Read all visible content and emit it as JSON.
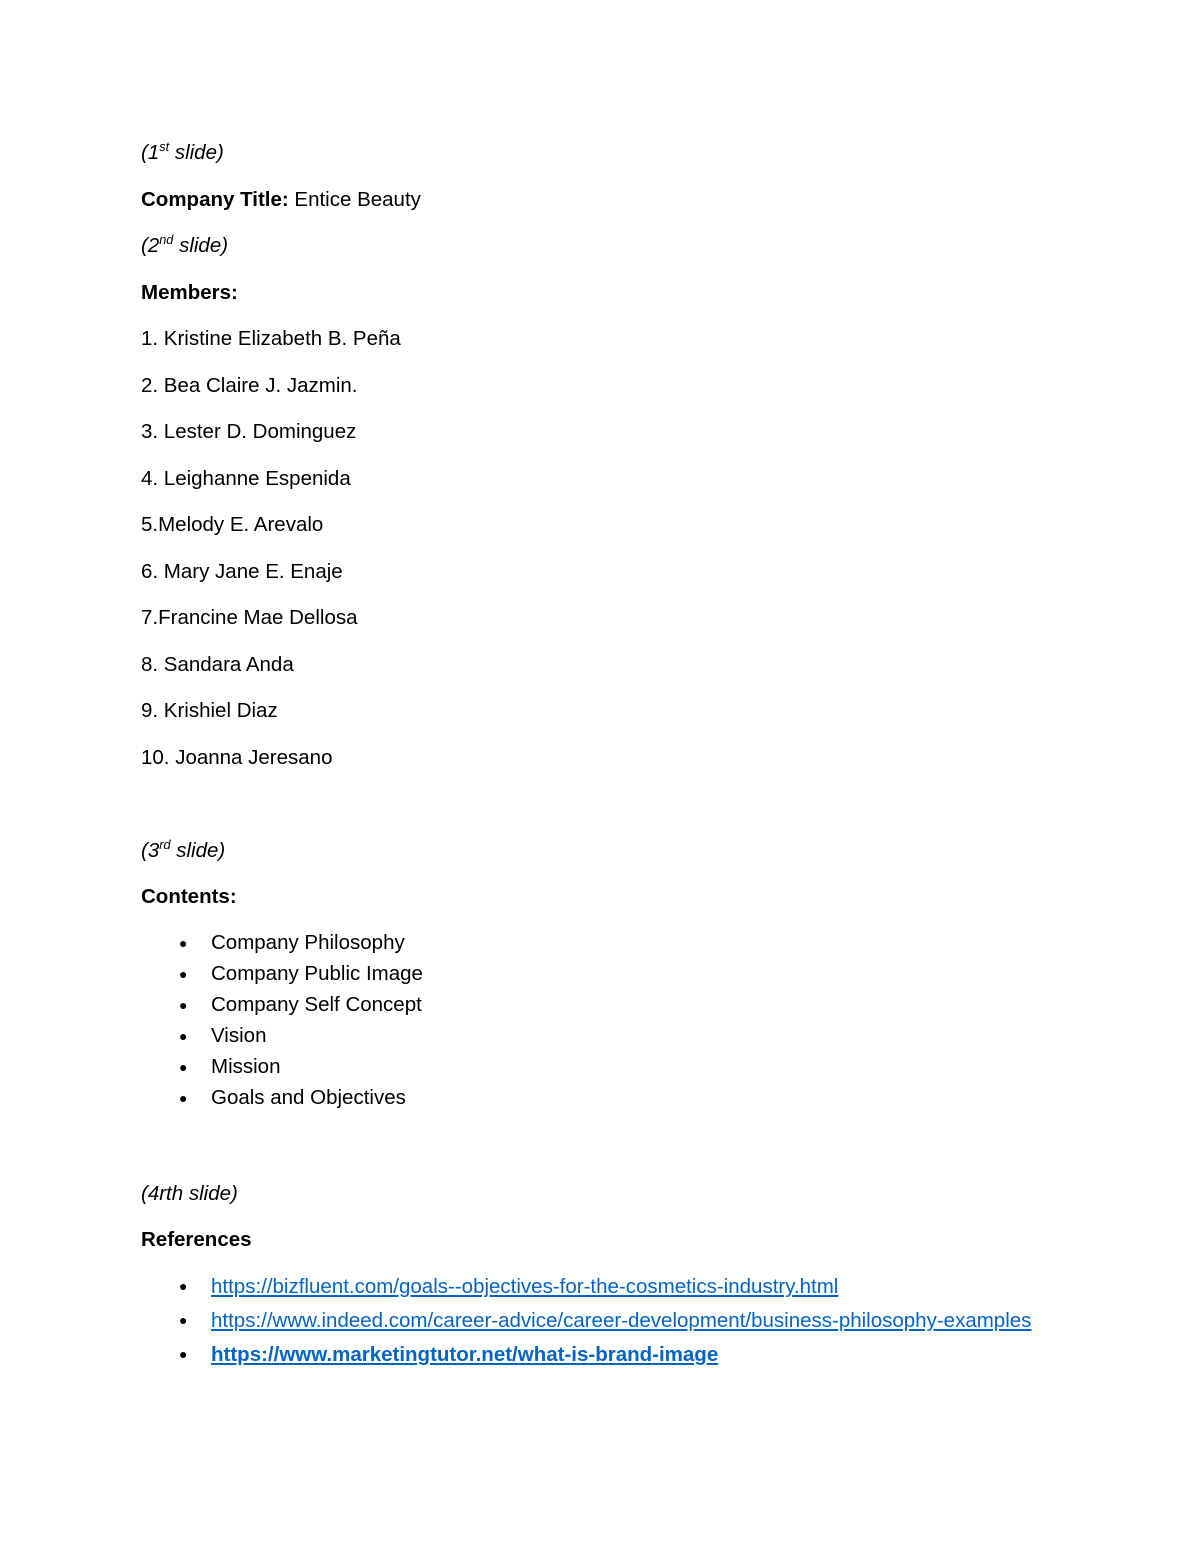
{
  "document": {
    "slide1": {
      "marker_prefix": "(1",
      "marker_sup": "st",
      "marker_suffix": " slide)",
      "title_label": "Company Title:",
      "title_value": " Entice Beauty"
    },
    "slide2": {
      "marker_prefix": "(2",
      "marker_sup": "nd",
      "marker_suffix": " slide)",
      "members_heading": "Members:",
      "members": [
        "1. Kristine Elizabeth B. Peña",
        "2. Bea Claire J. Jazmin.",
        "3. Lester D. Dominguez",
        "4. Leighanne Espenida",
        "5.Melody E. Arevalo",
        "6. Mary Jane E. Enaje",
        "7.Francine Mae Dellosa",
        "8. Sandara Anda",
        "9. Krishiel Diaz",
        "10. Joanna Jeresano"
      ]
    },
    "slide3": {
      "marker_prefix": "(3",
      "marker_sup": "rd",
      "marker_suffix": " slide)",
      "contents_heading": "Contents:",
      "contents": [
        "Company Philosophy",
        "Company Public Image",
        "Company Self Concept",
        "Vision",
        "Mission",
        "Goals and Objectives"
      ]
    },
    "slide4": {
      "marker": "(4rth slide)",
      "references_heading": "References",
      "references": [
        {
          "text": "https://bizfluent.com/goals--objectives-for-the-cosmetics-industry.html",
          "bold": false
        },
        {
          "text": "https://www.indeed.com/career-advice/career-development/business-philosophy-examples",
          "bold": false
        },
        {
          "text": "https://www.marketingtutor.net/what-is-brand-image",
          "bold": true
        }
      ]
    }
  },
  "colors": {
    "hyperlink": "#0563C1",
    "text": "#000000",
    "page_background": "#ffffff"
  }
}
